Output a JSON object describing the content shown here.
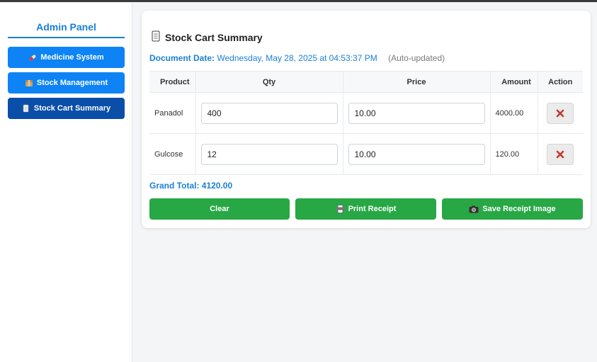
{
  "sidebar": {
    "title": "Admin Panel",
    "items": [
      {
        "label": "Medicine System",
        "icon": "pill-icon"
      },
      {
        "label": "Stock Management",
        "icon": "box-icon"
      },
      {
        "label": "Stock Cart Summary",
        "icon": "scroll-icon",
        "active": true
      }
    ]
  },
  "main": {
    "title": "Stock Cart Summary",
    "title_icon": "scroll-icon",
    "doc_date_label": "Document Date:",
    "doc_date_value": "Wednesday, May 28, 2025 at 04:53:37 PM",
    "auto_updated": "(Auto-updated)",
    "table": {
      "headers": [
        "Product",
        "Qty",
        "Price",
        "Amount",
        "Action"
      ],
      "rows": [
        {
          "product": "Panadol",
          "qty": "400",
          "price": "10.00",
          "amount": "4000.00"
        },
        {
          "product": "Gulcose",
          "qty": "12",
          "price": "10.00",
          "amount": "120.00"
        }
      ]
    },
    "grand_total": "Grand Total: 4120.00",
    "buttons": {
      "clear": "Clear",
      "print": "Print Receipt",
      "save_image": "Save Receipt Image"
    }
  },
  "colors": {
    "accent": "#1a7fd6",
    "nav": "#0d83f5",
    "nav_active": "#0a4ea8",
    "success": "#28a745",
    "delete_x": "#c0392b"
  }
}
